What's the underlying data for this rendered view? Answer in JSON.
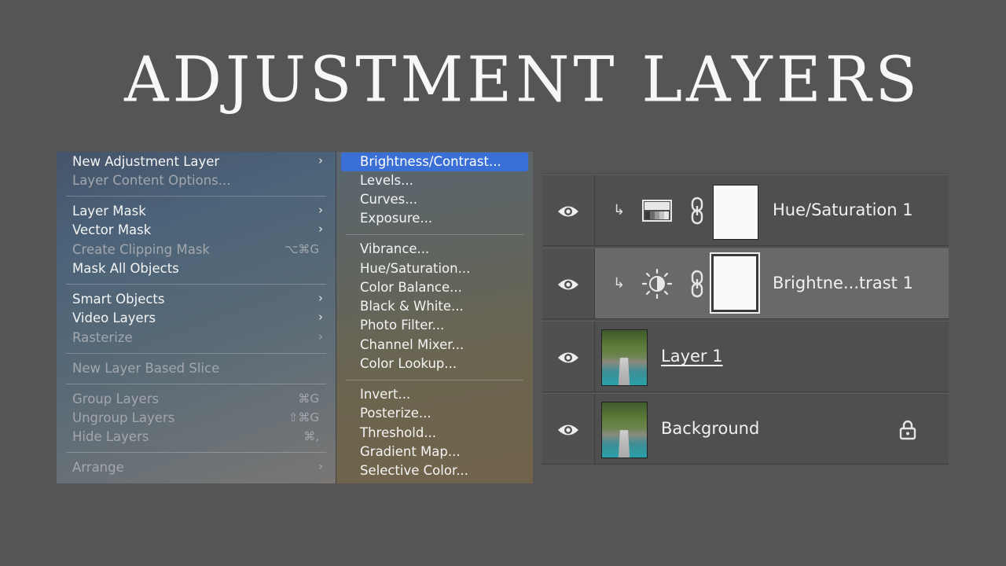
{
  "colors": {
    "page_bg": "#555555",
    "highlight": "#3a6fd6"
  },
  "title": "ADJUSTMENT LAYERS",
  "main_menu": {
    "items": [
      {
        "label": "New Adjustment Layer",
        "arrow": "›",
        "shortcut": "",
        "disabled": false
      },
      {
        "label": "Layer Content Options...",
        "arrow": "",
        "shortcut": "",
        "disabled": true
      },
      {
        "label": "Layer Mask",
        "arrow": "›",
        "shortcut": "",
        "disabled": false
      },
      {
        "label": "Vector Mask",
        "arrow": "›",
        "shortcut": "",
        "disabled": false
      },
      {
        "label": "Create Clipping Mask",
        "arrow": "",
        "shortcut": "⌥⌘G",
        "disabled": true
      },
      {
        "label": "Mask All Objects",
        "arrow": "",
        "shortcut": "",
        "disabled": false
      },
      {
        "label": "Smart Objects",
        "arrow": "›",
        "shortcut": "",
        "disabled": false
      },
      {
        "label": "Video Layers",
        "arrow": "›",
        "shortcut": "",
        "disabled": false
      },
      {
        "label": "Rasterize",
        "arrow": "›",
        "shortcut": "",
        "disabled": true
      },
      {
        "label": "New Layer Based Slice",
        "arrow": "",
        "shortcut": "",
        "disabled": true
      },
      {
        "label": "Group Layers",
        "arrow": "",
        "shortcut": "⌘G",
        "disabled": true
      },
      {
        "label": "Ungroup Layers",
        "arrow": "",
        "shortcut": "⇧⌘G",
        "disabled": true
      },
      {
        "label": "Hide Layers",
        "arrow": "",
        "shortcut": "⌘,",
        "disabled": true
      },
      {
        "label": "Arrange",
        "arrow": "›",
        "shortcut": "",
        "disabled": true
      }
    ]
  },
  "sub_menu": {
    "items": [
      {
        "label": "Brightness/Contrast...",
        "highlighted": true
      },
      {
        "label": "Levels..."
      },
      {
        "label": "Curves..."
      },
      {
        "label": "Exposure..."
      },
      {
        "label": "Vibrance..."
      },
      {
        "label": "Hue/Saturation..."
      },
      {
        "label": "Color Balance..."
      },
      {
        "label": "Black & White..."
      },
      {
        "label": "Photo Filter..."
      },
      {
        "label": "Channel Mixer..."
      },
      {
        "label": "Color Lookup..."
      },
      {
        "label": "Invert..."
      },
      {
        "label": "Posterize..."
      },
      {
        "label": "Threshold..."
      },
      {
        "label": "Gradient Map..."
      },
      {
        "label": "Selective Color..."
      }
    ]
  },
  "layers_panel": {
    "layers": [
      {
        "name": "Hue/Saturation 1",
        "icon": "hue-saturation-icon",
        "selected": false
      },
      {
        "name": "Brightne...trast 1",
        "icon": "brightness-contrast-icon",
        "selected": true
      },
      {
        "name": "Layer 1",
        "icon": "photo-thumbnail",
        "selected": false
      },
      {
        "name": "Background",
        "icon": "photo-thumbnail",
        "locked": true,
        "selected": false
      }
    ]
  }
}
